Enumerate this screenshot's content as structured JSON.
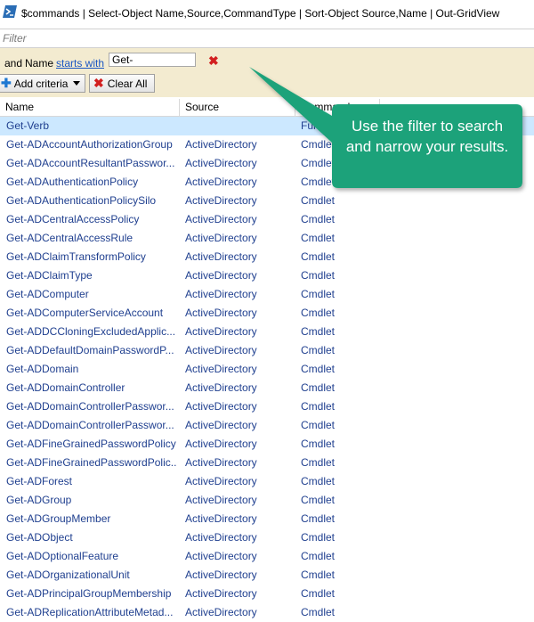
{
  "window": {
    "title": "$commands | Select-Object Name,Source,CommandType | Sort-Object Source,Name | Out-GridView"
  },
  "filter": {
    "placeholder": "Filter"
  },
  "criteria": {
    "conjunction": "and",
    "field": "Name",
    "operator": "starts with",
    "value": "Get-"
  },
  "toolbar": {
    "add_criteria_label": "Add criteria",
    "clear_all_label": "Clear All"
  },
  "columns": [
    "Name",
    "Source",
    "Command"
  ],
  "rows": [
    {
      "name": "Get-Verb",
      "source": "",
      "type": "Function"
    },
    {
      "name": "Get-ADAccountAuthorizationGroup",
      "source": "ActiveDirectory",
      "type": "Cmdlet"
    },
    {
      "name": "Get-ADAccountResultantPasswor...",
      "source": "ActiveDirectory",
      "type": "Cmdlet"
    },
    {
      "name": "Get-ADAuthenticationPolicy",
      "source": "ActiveDirectory",
      "type": "Cmdlet"
    },
    {
      "name": "Get-ADAuthenticationPolicySilo",
      "source": "ActiveDirectory",
      "type": "Cmdlet"
    },
    {
      "name": "Get-ADCentralAccessPolicy",
      "source": "ActiveDirectory",
      "type": "Cmdlet"
    },
    {
      "name": "Get-ADCentralAccessRule",
      "source": "ActiveDirectory",
      "type": "Cmdlet"
    },
    {
      "name": "Get-ADClaimTransformPolicy",
      "source": "ActiveDirectory",
      "type": "Cmdlet"
    },
    {
      "name": "Get-ADClaimType",
      "source": "ActiveDirectory",
      "type": "Cmdlet"
    },
    {
      "name": "Get-ADComputer",
      "source": "ActiveDirectory",
      "type": "Cmdlet"
    },
    {
      "name": "Get-ADComputerServiceAccount",
      "source": "ActiveDirectory",
      "type": "Cmdlet"
    },
    {
      "name": "Get-ADDCCloningExcludedApplic...",
      "source": "ActiveDirectory",
      "type": "Cmdlet"
    },
    {
      "name": "Get-ADDefaultDomainPasswordP...",
      "source": "ActiveDirectory",
      "type": "Cmdlet"
    },
    {
      "name": "Get-ADDomain",
      "source": "ActiveDirectory",
      "type": "Cmdlet"
    },
    {
      "name": "Get-ADDomainController",
      "source": "ActiveDirectory",
      "type": "Cmdlet"
    },
    {
      "name": "Get-ADDomainControllerPasswor...",
      "source": "ActiveDirectory",
      "type": "Cmdlet"
    },
    {
      "name": "Get-ADDomainControllerPasswor...",
      "source": "ActiveDirectory",
      "type": "Cmdlet"
    },
    {
      "name": "Get-ADFineGrainedPasswordPolicy",
      "source": "ActiveDirectory",
      "type": "Cmdlet"
    },
    {
      "name": "Get-ADFineGrainedPasswordPolic...",
      "source": "ActiveDirectory",
      "type": "Cmdlet"
    },
    {
      "name": "Get-ADForest",
      "source": "ActiveDirectory",
      "type": "Cmdlet"
    },
    {
      "name": "Get-ADGroup",
      "source": "ActiveDirectory",
      "type": "Cmdlet"
    },
    {
      "name": "Get-ADGroupMember",
      "source": "ActiveDirectory",
      "type": "Cmdlet"
    },
    {
      "name": "Get-ADObject",
      "source": "ActiveDirectory",
      "type": "Cmdlet"
    },
    {
      "name": "Get-ADOptionalFeature",
      "source": "ActiveDirectory",
      "type": "Cmdlet"
    },
    {
      "name": "Get-ADOrganizationalUnit",
      "source": "ActiveDirectory",
      "type": "Cmdlet"
    },
    {
      "name": "Get-ADPrincipalGroupMembership",
      "source": "ActiveDirectory",
      "type": "Cmdlet"
    },
    {
      "name": "Get-ADReplicationAttributeMetad...",
      "source": "ActiveDirectory",
      "type": "Cmdlet"
    }
  ],
  "callout": {
    "text": "Use the filter to search and narrow your results.",
    "color": "#1fa27a"
  },
  "colors": {
    "criteria_bg": "#f3ebd0",
    "selected_row": "#cce8ff",
    "link": "#1a56c4",
    "remove_red": "#d21f1f"
  }
}
